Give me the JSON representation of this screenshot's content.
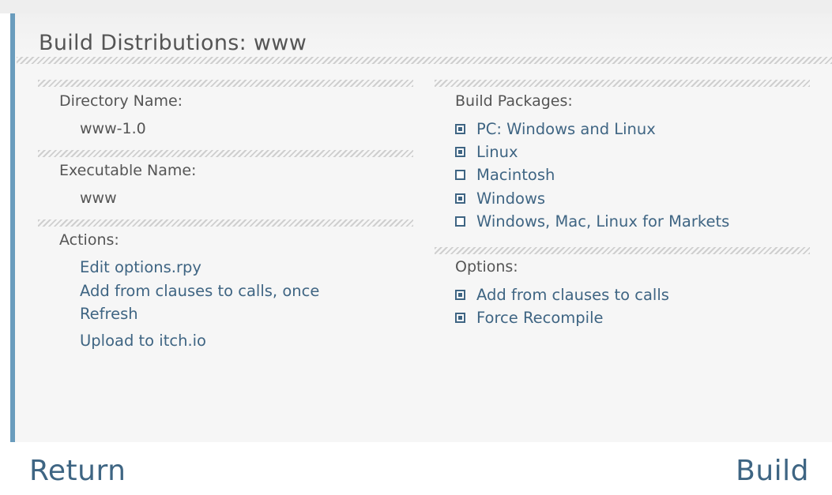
{
  "title": "Build Distributions: www",
  "left": {
    "directory": {
      "label": "Directory Name:",
      "value": "www-1.0"
    },
    "executable": {
      "label": "Executable Name:",
      "value": "www"
    },
    "actions": {
      "label": "Actions:",
      "items": [
        "Edit options.rpy",
        "Add from clauses to calls, once",
        "Refresh",
        "Upload to itch.io"
      ]
    }
  },
  "right": {
    "packages": {
      "label": "Build Packages:",
      "items": [
        {
          "label": "PC: Windows and Linux",
          "checked": true
        },
        {
          "label": "Linux",
          "checked": true
        },
        {
          "label": "Macintosh",
          "checked": false
        },
        {
          "label": "Windows",
          "checked": true
        },
        {
          "label": "Windows, Mac, Linux for Markets",
          "checked": false
        }
      ]
    },
    "options": {
      "label": "Options:",
      "items": [
        {
          "label": "Add from clauses to calls",
          "checked": true
        },
        {
          "label": "Force Recompile",
          "checked": true
        }
      ]
    }
  },
  "footer": {
    "return_label": "Return",
    "build_label": "Build"
  },
  "colors": {
    "accent": "#6a9cbd",
    "link": "#3f6583",
    "text": "#555555"
  }
}
